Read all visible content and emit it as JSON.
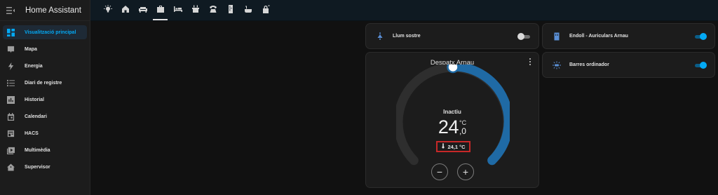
{
  "app": {
    "title": "Home Assistant"
  },
  "sidebar": {
    "items": [
      {
        "label": "Visualització principal",
        "icon": "dashboard-icon",
        "active": true
      },
      {
        "label": "Mapa",
        "icon": "map-account-icon",
        "active": false
      },
      {
        "label": "Energia",
        "icon": "lightning-bolt-icon",
        "active": false
      },
      {
        "label": "Diari de registre",
        "icon": "format-list-icon",
        "active": false
      },
      {
        "label": "Historial",
        "icon": "chart-box-icon",
        "active": false
      },
      {
        "label": "Calendari",
        "icon": "calendar-icon",
        "active": false
      },
      {
        "label": "HACS",
        "icon": "hacs-icon",
        "active": false
      },
      {
        "label": "Multimèdia",
        "icon": "play-box-icon",
        "active": false
      },
      {
        "label": "Supervisor",
        "icon": "home-assistant-icon",
        "active": false
      }
    ]
  },
  "topbar": {
    "tabs": [
      {
        "icon": "lightbulb-icon"
      },
      {
        "icon": "home-icon"
      },
      {
        "icon": "sofa-icon"
      },
      {
        "icon": "briefcase-icon",
        "active": true
      },
      {
        "icon": "bed-icon"
      },
      {
        "icon": "stove-icon"
      },
      {
        "icon": "phone-icon"
      },
      {
        "icon": "fridge-icon"
      },
      {
        "icon": "bathtub-icon"
      },
      {
        "icon": "lock-icon"
      }
    ]
  },
  "cards": {
    "ceiling_light": {
      "label": "Llum sostre",
      "icon": "ceiling-light-icon",
      "state": "off"
    },
    "headphones_plug": {
      "label": "Endoll - Auriculars Arnau",
      "icon": "power-socket-icon",
      "state": "on"
    },
    "desk_bars": {
      "label": "Barres ordinador",
      "icon": "light-bars-icon",
      "state": "on"
    }
  },
  "thermostat": {
    "title": "Despatx Arnau",
    "hvac_state": "Inactiu",
    "target_int": "24",
    "target_dec": ",0",
    "unit": "°C",
    "current": "24,1 °C",
    "minus": "−",
    "plus": "+"
  },
  "colors": {
    "accent": "#03a9f4",
    "arc_active": "#1f6aa5",
    "arc_track": "#2e2e2e",
    "highlight_box": "#c62828"
  }
}
